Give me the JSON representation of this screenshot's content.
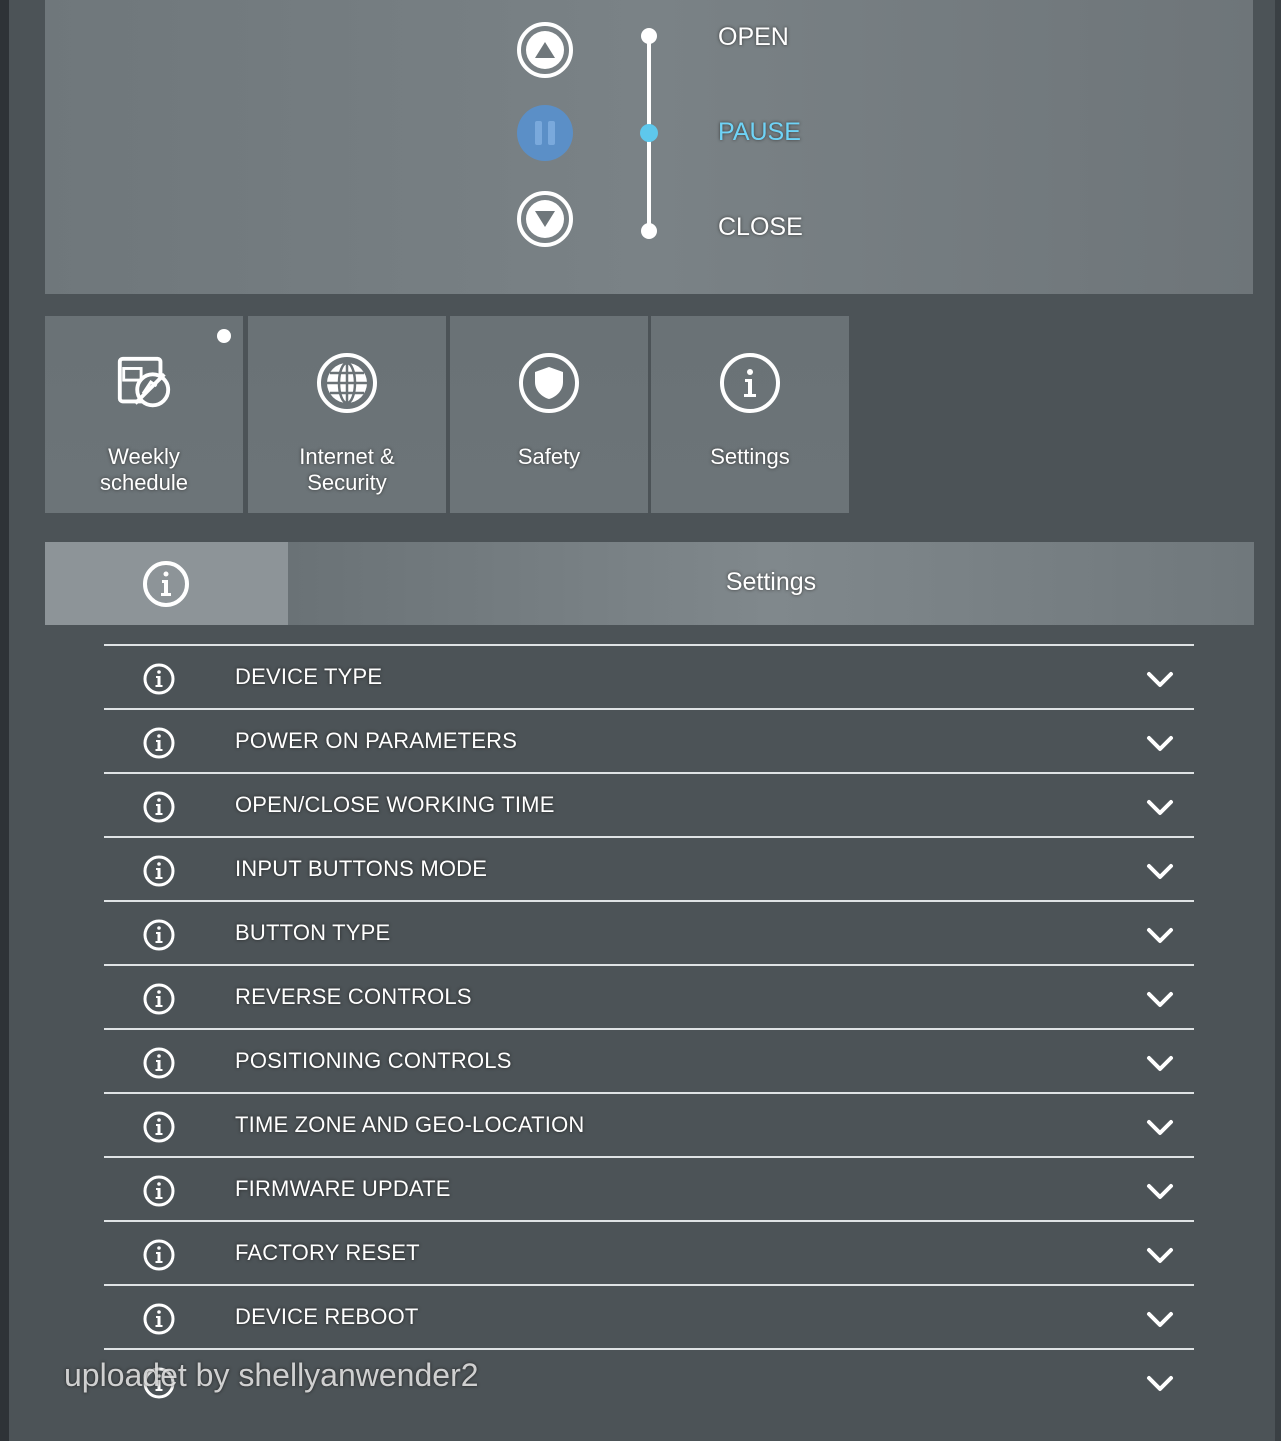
{
  "control": {
    "states": {
      "open": "OPEN",
      "pause": "PAUSE",
      "close": "CLOSE"
    },
    "active_state": "PAUSE",
    "active_color": "#5ec8ec"
  },
  "tiles": [
    {
      "label": "Weekly schedule",
      "icon": "calendar-icon",
      "notification": true
    },
    {
      "label": "Internet & Security",
      "icon": "globe-icon",
      "notification": false
    },
    {
      "label": "Safety",
      "icon": "shield-icon",
      "notification": false
    },
    {
      "label": "Settings",
      "icon": "info-icon",
      "notification": false
    }
  ],
  "settings_header": {
    "title": "Settings",
    "icon": "info-icon"
  },
  "settings_items": [
    "DEVICE TYPE",
    "POWER ON PARAMETERS",
    "OPEN/CLOSE WORKING TIME",
    "INPUT BUTTONS MODE",
    "BUTTON TYPE",
    "REVERSE CONTROLS",
    "POSITIONING CONTROLS",
    "TIME ZONE AND GEO-LOCATION",
    "FIRMWARE UPDATE",
    "FACTORY RESET",
    "DEVICE REBOOT",
    ""
  ],
  "watermark": "uploadet by shellyanwender2"
}
